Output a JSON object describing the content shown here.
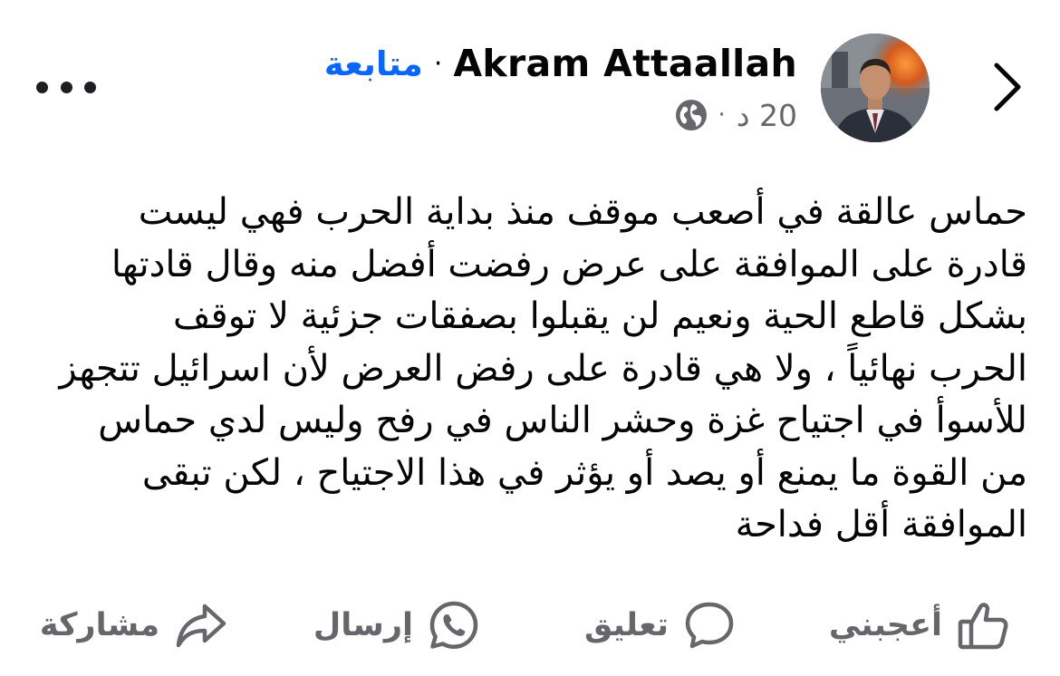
{
  "post": {
    "author": {
      "name": "Akram Attaallah",
      "follow_label": "متابعة",
      "name_separator": "·"
    },
    "meta": {
      "time": "20 د",
      "separator": "·",
      "audience_icon": "globe-icon"
    },
    "text_lines": [
      "حماس عالقة في  أصعب موقف منذ بداية الحرب فهي ليست",
      "قادرة على الموافقة على عرض رفضت أفضل منه وقال قادتها",
      "بشكل قاطع الحية ونعيم لن يقبلوا بصفقات جزئية لا توقف",
      "الحرب نهائياً ، ولا هي قادرة على رفض العرض لأن اسرائيل تتجهز",
      "للأسوأ في اجتياح غزة وحشر الناس في رفح وليس لدي حماس",
      "من القوة ما يمنع أو يصد أو يؤثر في هذا الاجتياح ، لكن تبقى",
      "الموافقة أقل فداحة"
    ]
  },
  "actions": {
    "like": {
      "label": "أعجبني",
      "icon": "thumbs-up-icon"
    },
    "comment": {
      "label": "تعليق",
      "icon": "comment-bubble-icon"
    },
    "send": {
      "label": "إرسال",
      "icon": "whatsapp-icon"
    },
    "share": {
      "label": "مشاركة",
      "icon": "share-arrow-icon"
    }
  },
  "navigation": {
    "back_icon": "chevron-right-icon",
    "more_icon": "more-options-icon"
  },
  "colors": {
    "link_blue": "#0866ff",
    "secondary_text": "#65676b",
    "primary_text": "#050505",
    "background": "#ffffff"
  }
}
